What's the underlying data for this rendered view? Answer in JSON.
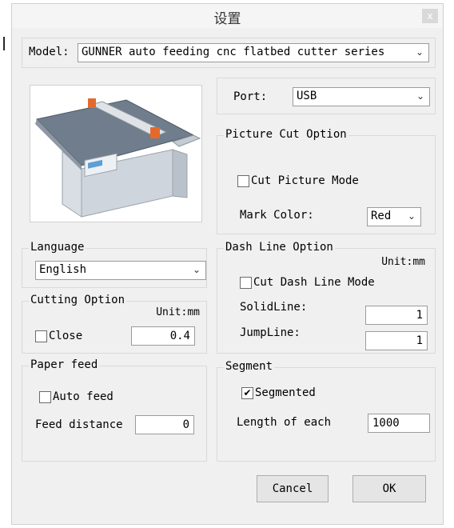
{
  "background_char": "l",
  "window": {
    "title": "设置",
    "close_glyph": "x"
  },
  "model": {
    "label": "Model:",
    "value": "GUNNER auto feeding cnc flatbed cutter series"
  },
  "port": {
    "label": "Port:",
    "value": "USB"
  },
  "picture_cut": {
    "title": "Picture Cut Option",
    "mode_label": "Cut Picture Mode",
    "mode_checked": false,
    "mark_color_label": "Mark Color:",
    "mark_color_value": "Red"
  },
  "language": {
    "title": "Language",
    "value": "English"
  },
  "dash_line": {
    "title": "Dash Line Option",
    "unit": "Unit:mm",
    "mode_label": "Cut Dash Line Mode",
    "mode_checked": false,
    "solid_label": "SolidLine:",
    "solid_value": "1",
    "jump_label": "JumpLine:",
    "jump_value": "1"
  },
  "cutting": {
    "title": "Cutting Option",
    "unit": "Unit:mm",
    "close_label": "Close",
    "close_checked": false,
    "value": "0.4"
  },
  "paper_feed": {
    "title": "Paper feed",
    "auto_label": "Auto feed",
    "auto_checked": false,
    "distance_label": "Feed distance",
    "distance_value": "0"
  },
  "segment": {
    "title": "Segment",
    "segmented_label": "Segmented",
    "segmented_checked": true,
    "length_label": "Length of each",
    "length_value": "1000"
  },
  "buttons": {
    "cancel": "Cancel",
    "ok": "OK"
  },
  "icons": {
    "dropdown": "chevron-down-icon",
    "check": "checkmark-icon"
  },
  "colors": {
    "dialog_bg": "#f0f0f0",
    "machine_body": "#dfe3e8",
    "machine_accent": "#e36a2c",
    "table_top": "#5d6b7a"
  }
}
